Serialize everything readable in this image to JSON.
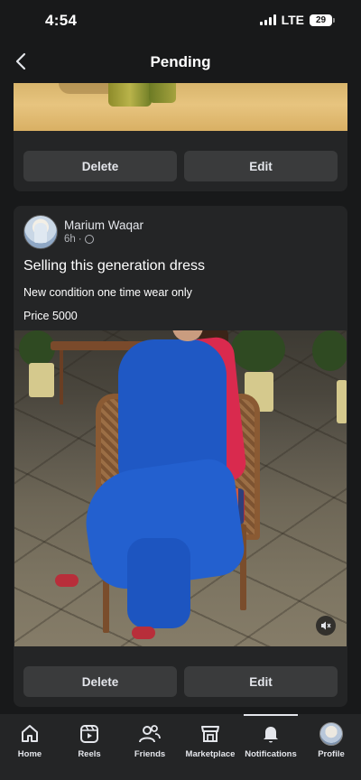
{
  "status_bar": {
    "time": "4:54",
    "network": "LTE",
    "battery": "29"
  },
  "header": {
    "title": "Pending"
  },
  "top_card": {
    "delete_label": "Delete",
    "edit_label": "Edit"
  },
  "post": {
    "author": "Marium Waqar",
    "time_ago": "6h",
    "separator": "·",
    "title": "Selling this generation dress",
    "line1": "New condition one time wear only",
    "line2": "Price 5000",
    "delete_label": "Delete",
    "edit_label": "Edit"
  },
  "bottom_nav": {
    "items": [
      {
        "label": "Home",
        "icon": "home-icon"
      },
      {
        "label": "Reels",
        "icon": "reels-icon"
      },
      {
        "label": "Friends",
        "icon": "friends-icon"
      },
      {
        "label": "Marketplace",
        "icon": "marketplace-icon"
      },
      {
        "label": "Notifications",
        "icon": "bell-icon"
      },
      {
        "label": "Profile",
        "icon": "profile-avatar"
      }
    ],
    "active": "Notifications"
  }
}
